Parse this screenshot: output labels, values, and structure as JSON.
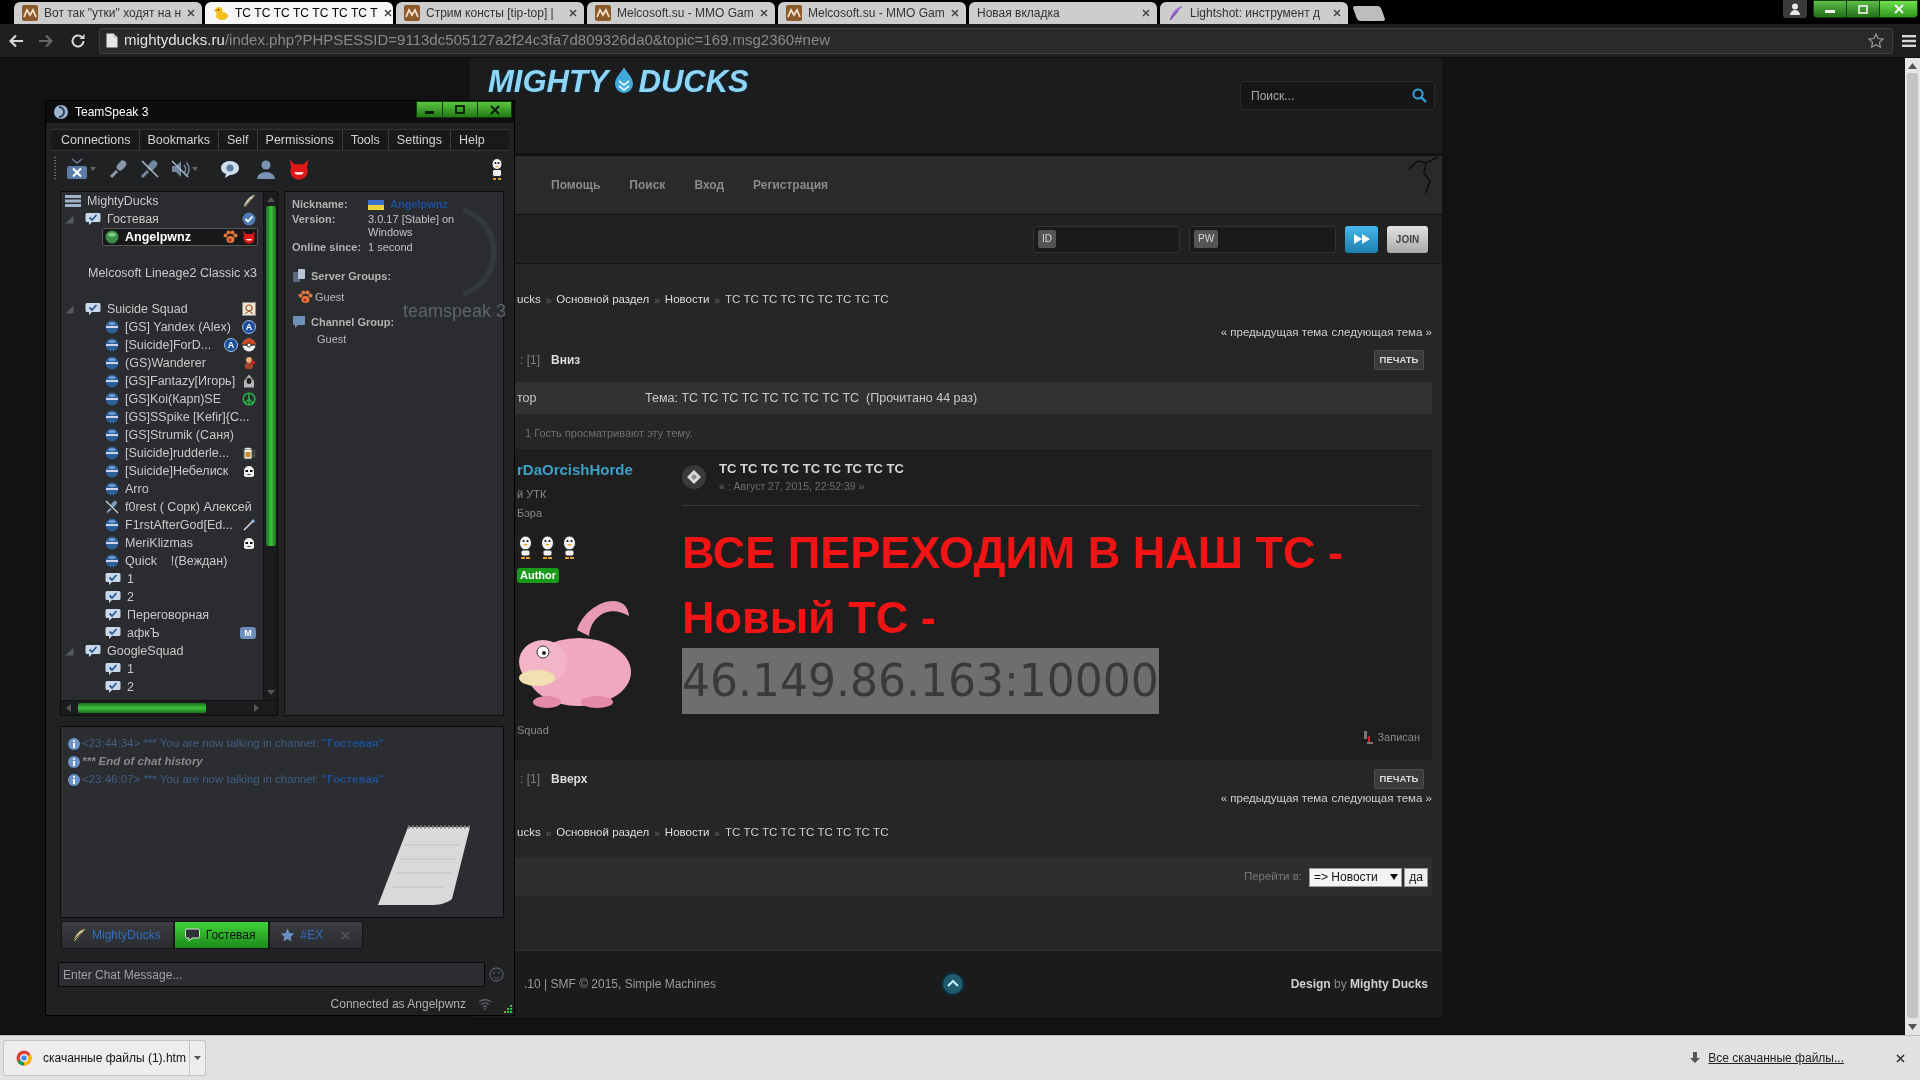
{
  "browser": {
    "tabs": [
      {
        "title": "Вот так \"утки\" ходят на н",
        "kind": "site",
        "selected": false
      },
      {
        "title": "ТС ТС ТС ТС ТС ТС ТС Т",
        "kind": "duck",
        "selected": true
      },
      {
        "title": "Стрим консты [tip-top] |",
        "kind": "site",
        "selected": false
      },
      {
        "title": "Melcosoft.su - MMO Gam",
        "kind": "site",
        "selected": false
      },
      {
        "title": "Melcosoft.su - MMO Gam",
        "kind": "site",
        "selected": false
      },
      {
        "title": "Новая вкладка",
        "kind": "blank",
        "selected": false
      },
      {
        "title": "Lightshot: инструмент д",
        "kind": "feather",
        "selected": false
      }
    ],
    "address": {
      "host": "mightyducks.ru",
      "path": "/index.php?PHPSESSID=9113dc505127a2f24c3fa7d809326da0&topic=169.msg2360#new"
    }
  },
  "teamspeak": {
    "title": "TeamSpeak 3",
    "menu": [
      "Connections",
      "Bookmarks",
      "Self",
      "Permissions",
      "Tools",
      "Settings",
      "Help"
    ],
    "tree": [
      {
        "label": "MightyDucks",
        "kind": "server",
        "selected": false,
        "badges": [
          {
            "kind": "quill"
          }
        ],
        "children": [
          {
            "label": "Гостевая",
            "kind": "channel",
            "selected": false,
            "expanded": true,
            "badges": [
              {
                "kind": "check"
              }
            ],
            "children": [
              {
                "label": "Angelpwnz",
                "kind": "client",
                "active": true,
                "muted": false,
                "selected": true,
                "badges": [
                  {
                    "kind": "paw"
                  },
                  {
                    "kind": "devil"
                  }
                ]
              }
            ]
          },
          {
            "label": "Melcosoft Lineage2 Classic x3",
            "kind": "spacer",
            "selected": false
          },
          {
            "label": "Suicide Squad",
            "kind": "channel",
            "selected": false,
            "expanded": true,
            "badges": [
              {
                "kind": "picture"
              }
            ],
            "children": [
              {
                "label": "[GS] Yandex (Alex)",
                "kind": "client",
                "active": false,
                "muted": false,
                "selected": false,
                "badges": [
                  {
                    "kind": "letter",
                    "text": "A"
                  }
                ]
              },
              {
                "label": "[Suicide]ForD...",
                "kind": "client",
                "active": false,
                "muted": false,
                "selected": false,
                "badges": [
                  {
                    "kind": "letter",
                    "text": "A"
                  },
                  {
                    "kind": "ball"
                  }
                ]
              },
              {
                "label": "(GS)Wanderer",
                "kind": "client",
                "active": false,
                "muted": false,
                "selected": false,
                "badges": [
                  {
                    "kind": "character"
                  }
                ]
              },
              {
                "label": "[GS]Fantazy[Игорь]",
                "kind": "client",
                "active": false,
                "muted": false,
                "selected": false,
                "badges": [
                  {
                    "kind": "hood"
                  }
                ]
              },
              {
                "label": "[GS]Koi(Карп)SE",
                "kind": "client",
                "active": false,
                "muted": false,
                "selected": false,
                "badges": [
                  {
                    "kind": "peace"
                  }
                ]
              },
              {
                "label": "[GS]SSpike [Kefir]{C...",
                "kind": "client",
                "active": false,
                "muted": false,
                "selected": false
              },
              {
                "label": "[GS]Strumik (Саня)",
                "kind": "client",
                "active": false,
                "muted": false,
                "selected": false
              },
              {
                "label": "[Suicide]rudderle...",
                "kind": "client",
                "active": false,
                "muted": false,
                "selected": false,
                "badges": [
                  {
                    "kind": "mug"
                  }
                ]
              },
              {
                "label": "[Suicide]Небелиск",
                "kind": "client",
                "active": false,
                "muted": false,
                "selected": false,
                "badges": [
                  {
                    "kind": "trooper"
                  }
                ]
              },
              {
                "label": "Arro",
                "kind": "client",
                "active": false,
                "muted": false,
                "selected": false
              },
              {
                "label": "f0rest ( Сорк) Алексей",
                "kind": "client",
                "active": false,
                "muted": true,
                "selected": false
              },
              {
                "label": "F1rstAfterGod[Ed...",
                "kind": "client",
                "active": false,
                "muted": false,
                "selected": false,
                "badges": [
                  {
                    "kind": "wand"
                  }
                ]
              },
              {
                "label": "MeriKlizmas",
                "kind": "client",
                "active": false,
                "muted": false,
                "selected": false,
                "badges": [
                  {
                    "kind": "trooper"
                  }
                ]
              },
              {
                "label": "Quick    !(Веждан)",
                "kind": "client",
                "active": false,
                "muted": false,
                "selected": false
              },
              {
                "label": "1",
                "kind": "channel",
                "selected": false
              },
              {
                "label": "2",
                "kind": "channel",
                "selected": false
              },
              {
                "label": "Переговорная",
                "kind": "channel",
                "selected": false
              },
              {
                "label": "афкЪ",
                "kind": "channel",
                "selected": false,
                "badges": [
                  {
                    "kind": "tag",
                    "text": "M"
                  }
                ]
              }
            ]
          },
          {
            "label": "GoogleSquad",
            "kind": "channel",
            "selected": false,
            "expanded": true,
            "children": [
              {
                "label": "1",
                "kind": "channel",
                "selected": false
              },
              {
                "label": "2",
                "kind": "channel",
                "selected": false
              }
            ]
          }
        ]
      }
    ],
    "info": {
      "nickname": {
        "label": "Nickname:",
        "value": "Angelpwnz"
      },
      "version": {
        "label": "Version:",
        "value": "3.0.17 [Stable] on Windows"
      },
      "online": {
        "label": "Online since:",
        "value": "1 second"
      },
      "server_groups": {
        "label": "Server Groups:",
        "items": [
          "Guest"
        ]
      },
      "channel_group": {
        "label": "Channel Group:",
        "value": "Guest"
      },
      "logo": "teamspeak 3"
    },
    "chat": {
      "messages": [
        {
          "kind": "notice",
          "time": "<23:44:34>",
          "text": "*** You are now talking in channel:",
          "channel": "\"Гостевая\""
        },
        {
          "kind": "history",
          "text": "*** End of chat history"
        },
        {
          "kind": "notice",
          "time": "<23:46:07>",
          "text": "*** You are now talking in channel:",
          "channel": "\"Гостевая\""
        }
      ],
      "tabs": [
        {
          "label": "MightyDucks",
          "kind": "server",
          "selected": false
        },
        {
          "label": "Гостевая",
          "kind": "channel",
          "selected": true
        },
        {
          "label": "#EX",
          "kind": "private",
          "selected": false
        }
      ],
      "input": {
        "placeholder": "Enter Chat Message..."
      },
      "status": "Connected as Angelpwnz"
    }
  },
  "forum": {
    "logo": {
      "left": "MIGHTY",
      "right": "DUCKS"
    },
    "search": {
      "placeholder": "Поиск..."
    },
    "nav": [
      "Помощь",
      "Поиск",
      "Вход",
      "Регистрация"
    ],
    "login": {
      "id_label": "ID",
      "pw_label": "PW",
      "join": "JOIN"
    },
    "breadcrumb_top": {
      "separator": "»",
      "items": [
        "ucks",
        "Основной раздел",
        "Новости",
        "ТС ТС ТС ТС ТС ТС ТС ТС ТС"
      ]
    },
    "topic_nav_top": {
      "prev": "« предыдущая тема",
      "next": "следующая тема »"
    },
    "pages_top": {
      "label": ": [1]",
      "jump": "Вниз",
      "print": "ПЕЧАТЬ"
    },
    "topic_header": {
      "author": "тор",
      "topic": "Тема: ТС ТС ТС ТС ТС ТС ТС ТС ТС  (Прочитано 44 раз)"
    },
    "viewers": "1 Гость просматривают эту тему.",
    "post": {
      "author": "rDaOrcishHorde",
      "rank": "й УТК",
      "group": "Бэра",
      "stars": 3,
      "badge": "Author",
      "team": "Squad",
      "title": "ТС ТС ТС ТС ТС ТС ТС ТС ТС",
      "date": "« : Август 27, 2015, 22:52:39 »",
      "body": [
        "ВСЕ ПЕРЕХОДИМ В НАШ ТС -",
        "Новый ТС -"
      ],
      "address": "46.149.86.163:10000",
      "logged": "Записан"
    },
    "pages_bottom": {
      "label": ": [1]",
      "jump": "Вверх",
      "print": "ПЕЧАТЬ"
    },
    "topic_nav_bottom": {
      "prev": "« предыдущая тема",
      "next": "следующая тема »"
    },
    "breadcrumb_bottom": {
      "separator": "»",
      "items": [
        "ucks",
        "Основной раздел",
        "Новости",
        "ТС ТС ТС ТС ТС ТС ТС ТС ТС"
      ]
    },
    "jump": {
      "label": "Перейти в:",
      "value": "=> Новости",
      "go": "да"
    },
    "footer": {
      "copyright": ".10 | SMF © 2015, Simple Machines",
      "design": "**Design** by **Mighty Ducks**"
    }
  },
  "downloads": {
    "file": "скачанные файлы (1).htm",
    "all": "Все скачанные файлы..."
  }
}
